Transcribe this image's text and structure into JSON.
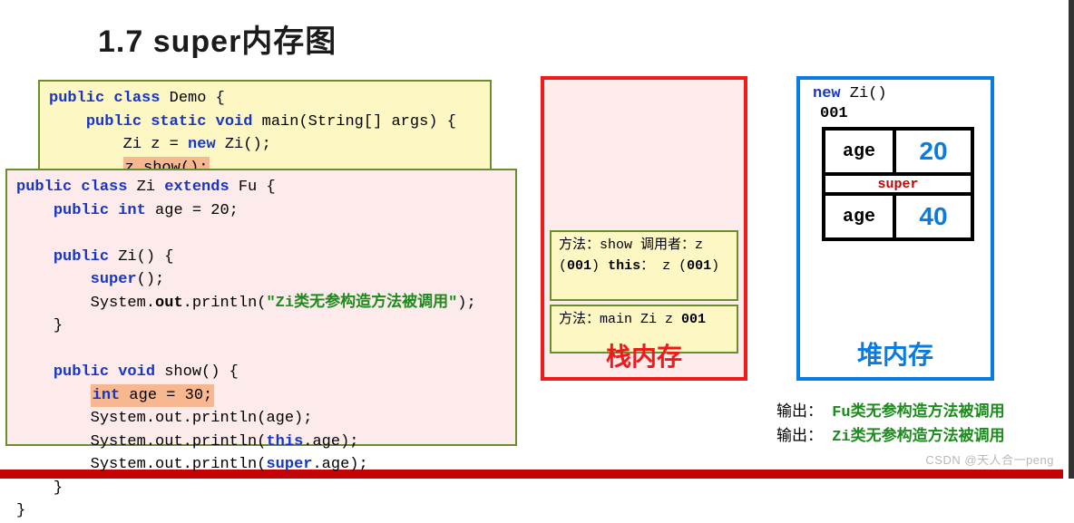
{
  "title": "1.7 super内存图",
  "code_demo": {
    "l1a": "public class",
    "l1b": " Demo {",
    "l2a": "public static void",
    "l2b": " main(String[] args) {",
    "l3a": "Zi z = ",
    "l3b": "new",
    "l3c": " Zi();",
    "l4": "z.show();"
  },
  "code_zi": {
    "l1a": "public class",
    "l1b": " Zi ",
    "l1c": "extends",
    "l1d": " Fu {",
    "l2a": "public int",
    "l2b": " age = 20;",
    "l3a": "public",
    "l3b": " Zi() {",
    "l4a": "super",
    "l4b": "();",
    "l5a": "System.",
    "l5b": "out",
    "l5c": ".println(",
    "l5d": "\"Zi类无参构造方法被调用\"",
    "l5e": ");",
    "l6": "}",
    "l7a": "public void",
    "l7b": " show() {",
    "l8a": "int",
    "l8b": " age = 30;",
    "l9": "System.out.println(age);",
    "l10a": "System.out.println(",
    "l10b": "this",
    "l10c": ".age);",
    "l11a": "System.out.println(",
    "l11b": "super",
    "l11c": ".age);",
    "l12": "}",
    "l13": "}"
  },
  "stack": {
    "show": {
      "l1": "方法：show",
      "l2a": "调用者：z (",
      "l2b": "001",
      "l2c": ")",
      "l3a": "this",
      "l3b": "： z (",
      "l3c": "001",
      "l3d": ")"
    },
    "main": {
      "l1": "方法：main",
      "l2a": " Zi z        ",
      "l2b": "001"
    },
    "label": "栈内存"
  },
  "heap": {
    "head_new": "new",
    "head_rest": " Zi()",
    "addr": "001",
    "row1_label": "age",
    "row1_val": "20",
    "sep": "super",
    "row2_label": "age",
    "row2_val": "40",
    "label": "堆内存"
  },
  "output": [
    {
      "lbl": "输出：",
      "msg": "Fu类无参构造方法被调用"
    },
    {
      "lbl": "输出：",
      "msg": "Zi类无参构造方法被调用"
    }
  ],
  "watermark": "CSDN @天人合一peng"
}
